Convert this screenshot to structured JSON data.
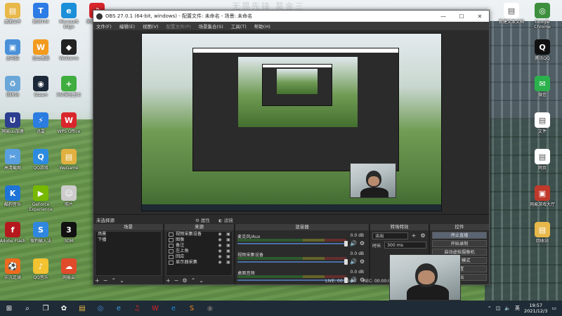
{
  "desktop": {
    "wall_text": "无畏先锋  莫金三",
    "icons_left": [
      {
        "label": "桌面文件",
        "icon": "folder-icon",
        "color": "#e8b84a",
        "glyph": "▤"
      },
      {
        "label": "腾讯TIM",
        "icon": "tim-icon",
        "color": "#2d7be5",
        "glyph": "T"
      },
      {
        "label": "Microsoft Edge",
        "icon": "edge-icon",
        "color": "#1b8fd8",
        "glyph": "e"
      },
      {
        "label": "网易云音乐",
        "icon": "netease-icon",
        "color": "#d9262c",
        "glyph": "♫"
      },
      {
        "label": "此电脑",
        "icon": "computer-icon",
        "color": "#4a90d9",
        "glyph": "▣"
      },
      {
        "label": "金山毒霸",
        "icon": "duba-icon",
        "color": "#f29b1e",
        "glyph": "W"
      },
      {
        "label": "WeGame",
        "icon": "wegame-icon",
        "color": "#222222",
        "glyph": "◆"
      },
      {
        "label": "回收站",
        "icon": "recycle-bin-icon",
        "color": "#6aa7d8",
        "glyph": "♻"
      },
      {
        "label": "Steam",
        "icon": "steam-icon",
        "color": "#1b2838",
        "glyph": "◉"
      },
      {
        "label": "360安全卫士",
        "icon": "360-icon",
        "color": "#3fae3f",
        "glyph": "+"
      },
      {
        "label": "网易uu加速",
        "icon": "uu-icon",
        "color": "#2c3e8f",
        "glyph": "U"
      },
      {
        "label": "迅雷",
        "icon": "xunlei-icon",
        "color": "#2b7de0",
        "glyph": "⚡"
      },
      {
        "label": "WPS Office",
        "icon": "wps-icon",
        "color": "#d9262c",
        "glyph": "W"
      },
      {
        "label": "高清截图",
        "icon": "capture-icon",
        "color": "#5a9fe0",
        "glyph": "✂"
      },
      {
        "label": "QQ游戏",
        "icon": "qqgame-icon",
        "color": "#2d8be0",
        "glyph": "Q"
      },
      {
        "label": "WeGame",
        "icon": "wegame2-icon",
        "color": "#e0b040",
        "glyph": "▤"
      },
      {
        "label": "酷狗音乐",
        "icon": "kugou-icon",
        "color": "#1f74d8",
        "glyph": "K"
      },
      {
        "label": "GeForce Experience",
        "icon": "nvidia-icon",
        "color": "#76b900",
        "glyph": "▶"
      },
      {
        "label": "照片",
        "icon": "photo-icon",
        "color": "#cccccc",
        "glyph": "☺"
      },
      {
        "label": "Adobe Flash",
        "icon": "flash-icon",
        "color": "#b5191d",
        "glyph": "f"
      },
      {
        "label": "搜狗输入法",
        "icon": "sogou-icon",
        "color": "#2f87e0",
        "glyph": "S"
      },
      {
        "label": "3DM",
        "icon": "3dm-icon",
        "color": "#111111",
        "glyph": "3"
      },
      {
        "label": "实况足球",
        "icon": "soccer-icon",
        "color": "#ef6a1e",
        "glyph": "⚽"
      },
      {
        "label": "QQ音乐",
        "icon": "qqmusic-icon",
        "color": "#f2c230",
        "glyph": "♪"
      },
      {
        "label": "网易云",
        "icon": "cloud-icon",
        "color": "#e04b2b",
        "glyph": "☁"
      }
    ],
    "icons_right": [
      {
        "label": "新建文本文档",
        "icon": "text-doc-icon",
        "color": "#ffffff",
        "glyph": "▤"
      },
      {
        "label": "Google Chrome",
        "icon": "chrome-icon",
        "color": "#3d8f3d",
        "glyph": "◎"
      },
      {
        "label": "腾讯QQ",
        "icon": "qq-icon",
        "color": "#111111",
        "glyph": "Q"
      },
      {
        "label": "微信",
        "icon": "wechat-icon",
        "color": "#2bb24c",
        "glyph": "✉"
      },
      {
        "label": "文件",
        "icon": "file-icon",
        "color": "#ffffff",
        "glyph": "▤"
      },
      {
        "label": "网页",
        "icon": "web-icon",
        "color": "#ffffff",
        "glyph": "▤"
      },
      {
        "label": "网易游戏大厅",
        "icon": "game-hall-icon",
        "color": "#c0392b",
        "glyph": "▣"
      },
      {
        "label": "回收站",
        "icon": "folder2-icon",
        "color": "#e8b84a",
        "glyph": "▤"
      }
    ]
  },
  "obs": {
    "title": "OBS 27.0.1 (64-bit, windows) - 配置文件: 未命名 - 场景: 未命名",
    "menu": [
      "文件(F)",
      "编辑(E)",
      "视图(V)",
      "配置文件(P)",
      "场景集合(S)",
      "工具(T)",
      "帮助(H)"
    ],
    "status_left": "未选择源",
    "status_props": "属性",
    "status_filters": "滤镜",
    "docks": {
      "scenes": {
        "title": "场景",
        "items": [
          "场景",
          "下播"
        ]
      },
      "sources": {
        "title": "来源",
        "items": [
          "视频采集设备",
          "图像",
          "备注",
          "左上角",
          "回应",
          "显示器采集"
        ]
      },
      "mixer": {
        "title": "混音器",
        "channels": [
          {
            "name": "麦克风/Aux",
            "db": "0.0 dB",
            "muted": false
          },
          {
            "name": "视频采集设备",
            "db": "0.0 dB",
            "muted": true
          },
          {
            "name": "桌面音频",
            "db": "0.0 dB",
            "muted": false
          }
        ]
      },
      "transitions": {
        "title": "转场特效",
        "selected": "淡出",
        "duration_label": "时长",
        "duration_value": "300 ms"
      },
      "controls": {
        "title": "控件",
        "buttons": [
          "停止直播",
          "开始录制",
          "启动虚拟摄像机",
          "工作室模式",
          "设置",
          "退出"
        ]
      }
    },
    "statusbar": {
      "live": "LIVE: 00:00:00",
      "rec": "REC: 00:00:00"
    }
  },
  "taskbar": {
    "apps": [
      {
        "name": "start-icon",
        "glyph": "⊞",
        "color": "#ffffff"
      },
      {
        "name": "search-icon",
        "glyph": "⌕",
        "color": "#ffffff"
      },
      {
        "name": "task-view-icon",
        "glyph": "❐",
        "color": "#ffffff"
      },
      {
        "name": "app-fan-icon",
        "glyph": "✿",
        "color": "#ffffff"
      },
      {
        "name": "file-explorer-icon",
        "glyph": "▤",
        "color": "#e8b84a"
      },
      {
        "name": "chrome-taskbar-icon",
        "glyph": "◎",
        "color": "#4a90d9"
      },
      {
        "name": "edge-taskbar-icon",
        "glyph": "e",
        "color": "#3aa0e0"
      },
      {
        "name": "netease-taskbar-icon",
        "glyph": "♫",
        "color": "#d9262c"
      },
      {
        "name": "wps-taskbar-icon",
        "glyph": "W",
        "color": "#d9262c"
      },
      {
        "name": "edge2-taskbar-icon",
        "glyph": "e",
        "color": "#1b8fd8"
      },
      {
        "name": "sublime-taskbar-icon",
        "glyph": "S",
        "color": "#f08a24"
      },
      {
        "name": "obs-taskbar-icon",
        "glyph": "◉",
        "color": "#666666"
      }
    ],
    "ime": "英",
    "time": "19:57",
    "date": "2021/12/3"
  }
}
